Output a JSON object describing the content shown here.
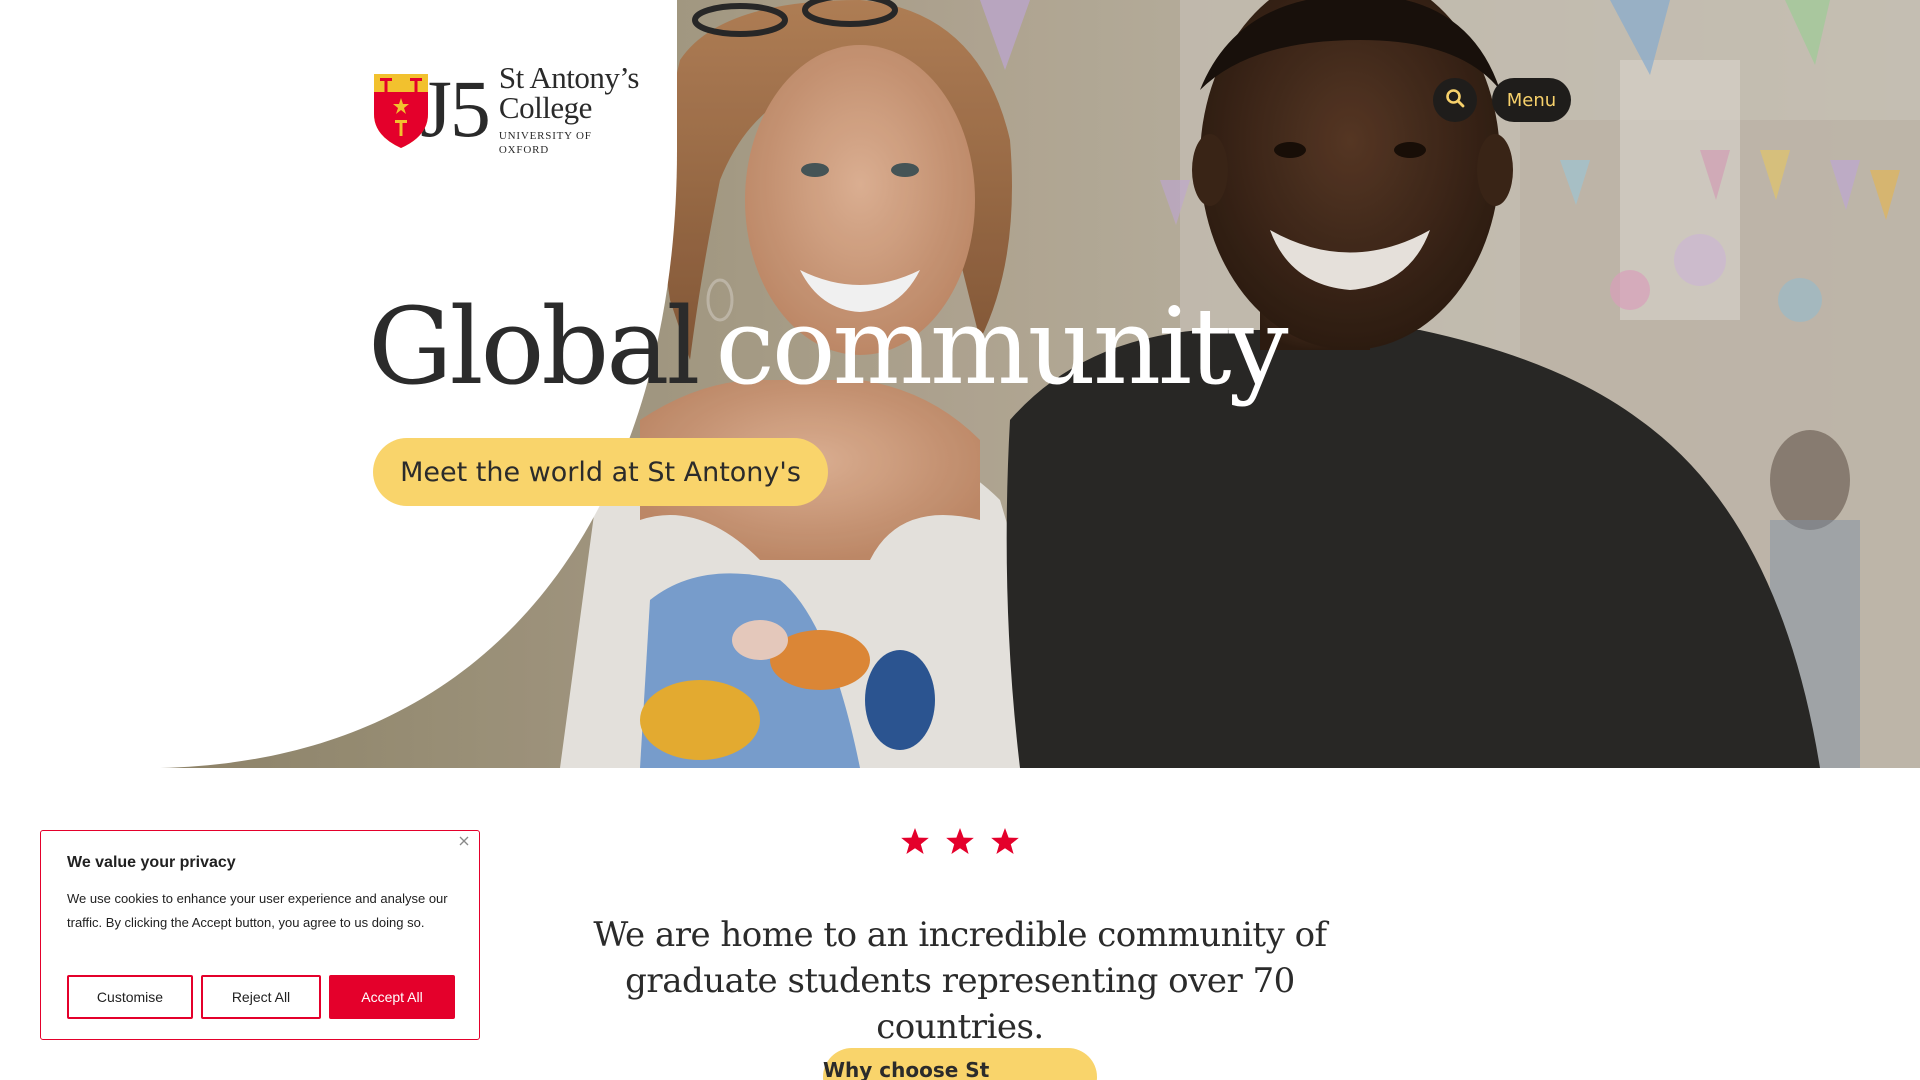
{
  "brand": {
    "line1": "St Antony’s",
    "line2": "College",
    "line3": "UNIVERSITY OF OXFORD",
    "numeral": "J5",
    "colors": {
      "accent_yellow": "#f9d46b",
      "dark": "#1f1d1b",
      "brand_red": "#e4002b",
      "shield_yellow": "#f2c12e",
      "text": "#2b2b2b"
    }
  },
  "header": {
    "search_icon": "search-icon",
    "menu_label": "Menu"
  },
  "hero": {
    "title_word1": "Global",
    "title_word2": "community",
    "cta_label": "Meet the world at St Antony's"
  },
  "intro": {
    "stars_count": 3,
    "text": "We are home to an incredible community of graduate students representing over 70 countries.",
    "button_label": "Why choose St Antony’s?"
  },
  "cookie_banner": {
    "title": "We value your privacy",
    "text": "We use cookies to enhance your user experience and analyse our traffic. By clicking the Accept button, you agree to us doing so.",
    "close_icon": "close-icon",
    "buttons": {
      "customise": "Customise",
      "reject": "Reject All",
      "accept": "Accept All"
    }
  }
}
